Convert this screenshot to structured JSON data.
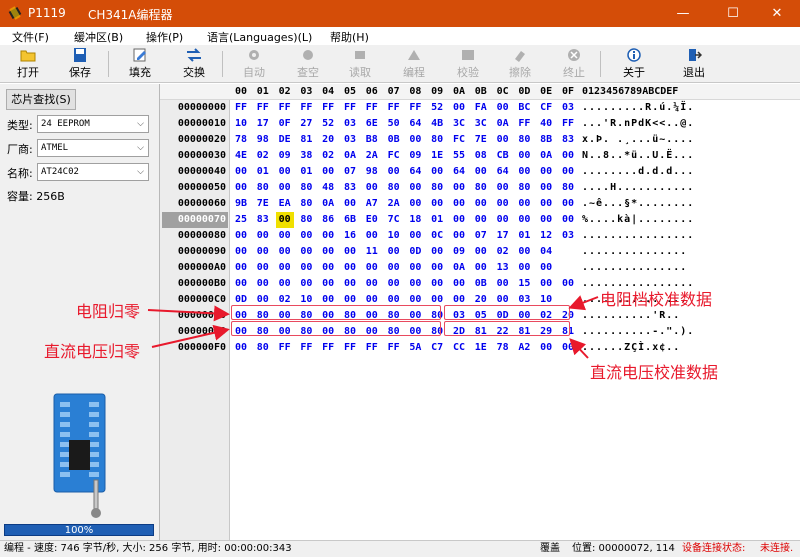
{
  "window": {
    "app_name": "P1119",
    "title": "CH341A编程器",
    "min": "—",
    "max": "☐",
    "close": "✕"
  },
  "menu": [
    "文件(F)",
    "缓冲区(B)",
    "操作(P)",
    "语言(Languages)(L)",
    "帮助(H)"
  ],
  "toolbar": [
    {
      "label": "打开",
      "icon": "open-folder-icon",
      "enabled": true
    },
    {
      "label": "保存",
      "icon": "save-disk-icon",
      "enabled": true
    },
    {
      "label": "填充",
      "icon": "fill-edit-icon",
      "enabled": true
    },
    {
      "label": "交换",
      "icon": "swap-arrows-icon",
      "enabled": true
    },
    {
      "label": "自动",
      "icon": "auto-gear-icon",
      "enabled": false
    },
    {
      "label": "查空",
      "icon": "blank-check-icon",
      "enabled": false
    },
    {
      "label": "读取",
      "icon": "read-icon",
      "enabled": false
    },
    {
      "label": "编程",
      "icon": "program-icon",
      "enabled": false
    },
    {
      "label": "校验",
      "icon": "verify-icon",
      "enabled": false
    },
    {
      "label": "擦除",
      "icon": "erase-icon",
      "enabled": false
    },
    {
      "label": "终止",
      "icon": "stop-icon",
      "enabled": false
    },
    {
      "label": "关于",
      "icon": "about-info-icon",
      "enabled": true
    },
    {
      "label": "退出",
      "icon": "exit-door-icon",
      "enabled": true
    }
  ],
  "left": {
    "chip_search": "芯片查找(S)",
    "type_label": "类型:",
    "type_value": "24 EEPROM",
    "maker_label": "厂商:",
    "maker_value": "ATMEL",
    "name_label": "名称:",
    "name_value": "AT24C02",
    "capacity": "容量: 256B",
    "progress_text": "100%",
    "progress_value": 1.0
  },
  "hex": {
    "header_cols": [
      "00",
      "01",
      "02",
      "03",
      "04",
      "05",
      "06",
      "07",
      "08",
      "09",
      "0A",
      "0B",
      "0C",
      "0D",
      "0E",
      "0F"
    ],
    "ascii_header": "0123456789ABCDEF",
    "selected_row": 7,
    "cursor": {
      "row": 7,
      "col": 2
    },
    "rows": [
      {
        "addr": "00000000",
        "bytes": [
          "FF",
          "FF",
          "FF",
          "FF",
          "FF",
          "FF",
          "FF",
          "FF",
          "FF",
          "52",
          "00",
          "FA",
          "00",
          "BC",
          "CF",
          "03"
        ],
        "ascii": ".........R.ú.¼Ï."
      },
      {
        "addr": "00000010",
        "bytes": [
          "10",
          "17",
          "0F",
          "27",
          "52",
          "03",
          "6E",
          "50",
          "64",
          "4B",
          "3C",
          "3C",
          "0A",
          "FF",
          "40",
          "FF"
        ],
        "ascii": "...'R.nPdK<<..@."
      },
      {
        "addr": "00000020",
        "bytes": [
          "78",
          "98",
          "DE",
          "81",
          "20",
          "03",
          "B8",
          "0B",
          "00",
          "80",
          "FC",
          "7E",
          "00",
          "80",
          "8B",
          "83"
        ],
        "ascii": "x.Þ. .¸...ü~...."
      },
      {
        "addr": "00000030",
        "bytes": [
          "4E",
          "02",
          "09",
          "38",
          "02",
          "0A",
          "2A",
          "FC",
          "09",
          "1E",
          "55",
          "08",
          "CB",
          "00",
          "0A",
          "00"
        ],
        "ascii": "N..8..*ü..U.Ë..."
      },
      {
        "addr": "00000040",
        "bytes": [
          "00",
          "01",
          "00",
          "01",
          "00",
          "07",
          "98",
          "00",
          "64",
          "00",
          "64",
          "00",
          "64",
          "00",
          "00",
          "00"
        ],
        "ascii": "........d.d.d..."
      },
      {
        "addr": "00000050",
        "bytes": [
          "00",
          "80",
          "00",
          "80",
          "48",
          "83",
          "00",
          "80",
          "00",
          "80",
          "00",
          "80",
          "00",
          "80",
          "00",
          "80"
        ],
        "ascii": "....H..........."
      },
      {
        "addr": "00000060",
        "bytes": [
          "9B",
          "7E",
          "EA",
          "80",
          "0A",
          "00",
          "A7",
          "2A",
          "00",
          "00",
          "00",
          "00",
          "00",
          "00",
          "00",
          "00"
        ],
        "ascii": ".~ê...§*........"
      },
      {
        "addr": "00000070",
        "bytes": [
          "25",
          "83",
          "00",
          "80",
          "86",
          "6B",
          "E0",
          "7C",
          "18",
          "01",
          "00",
          "00",
          "00",
          "00",
          "00",
          "00"
        ],
        "ascii": "%....kà|........"
      },
      {
        "addr": "00000080",
        "bytes": [
          "00",
          "00",
          "00",
          "00",
          "00",
          "16",
          "00",
          "10",
          "00",
          "0C",
          "00",
          "07",
          "17",
          "01",
          "12",
          "03"
        ],
        "ascii": "................"
      },
      {
        "addr": "00000090",
        "bytes": [
          "00",
          "00",
          "00",
          "00",
          "00",
          "00",
          "11",
          "00",
          "0D",
          "00",
          "09",
          "00",
          "02",
          "00",
          "04"
        ],
        "ascii": "..............."
      },
      {
        "addr": "000000A0",
        "bytes": [
          "00",
          "00",
          "00",
          "00",
          "00",
          "00",
          "00",
          "00",
          "00",
          "00",
          "0A",
          "00",
          "13",
          "00",
          "00"
        ],
        "ascii": "..............."
      },
      {
        "addr": "000000B0",
        "bytes": [
          "00",
          "00",
          "00",
          "00",
          "00",
          "00",
          "00",
          "00",
          "00",
          "00",
          "00",
          "0B",
          "00",
          "15",
          "00",
          "00"
        ],
        "ascii": "................"
      },
      {
        "addr": "000000C0",
        "bytes": [
          "0D",
          "00",
          "02",
          "10",
          "00",
          "00",
          "00",
          "00",
          "00",
          "00",
          "00",
          "20",
          "00",
          "03",
          "10"
        ],
        "ascii": "........... ..."
      },
      {
        "addr": "000000D0",
        "bytes": [
          "00",
          "80",
          "00",
          "80",
          "00",
          "80",
          "00",
          "80",
          "00",
          "80",
          "03",
          "05",
          "0D",
          "00",
          "02",
          "20"
        ],
        "ascii": "..........'R.. "
      },
      {
        "addr": "000000E0",
        "bytes": [
          "00",
          "80",
          "00",
          "80",
          "00",
          "80",
          "00",
          "80",
          "00",
          "80",
          "2D",
          "81",
          "22",
          "81",
          "29",
          "81"
        ],
        "ascii": "..........-.\".)."
      },
      {
        "addr": "000000F0",
        "bytes": [
          "00",
          "80",
          "FF",
          "FF",
          "FF",
          "FF",
          "FF",
          "FF",
          "5A",
          "C7",
          "CC",
          "1E",
          "78",
          "A2",
          "00",
          "00"
        ],
        "ascii": "......ZÇÌ.x¢.."
      }
    ]
  },
  "annotations": {
    "resistance_zero": "电阻归零",
    "dcv_zero": "直流电压归零",
    "resistance_cal": "电阻档校准数据",
    "dcv_cal": "直流电压校准数据",
    "color": "#e8192c"
  },
  "status": {
    "mode": "编程 - 速度: 746 字节/秒, 大小: 256 字节, 用时: 00:00:00:343",
    "overwrite": "覆盖",
    "position": "位置: 00000072, 114",
    "conn_label": "设备连接状态:",
    "conn_value": "未连接."
  }
}
